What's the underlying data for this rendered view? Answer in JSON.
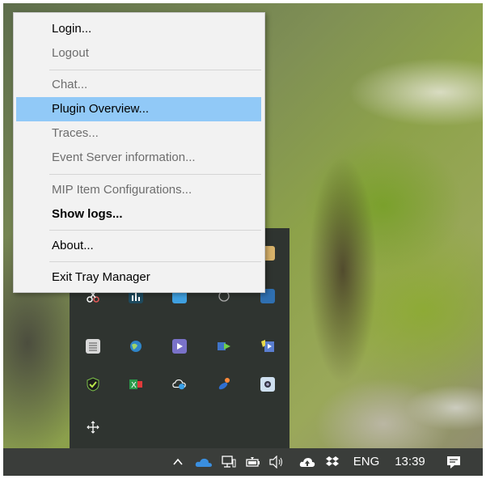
{
  "context_menu": {
    "items": [
      {
        "label": "Login...",
        "state": "enabled"
      },
      {
        "label": "Logout",
        "state": "disabled"
      },
      {
        "label": "Chat...",
        "state": "disabled"
      },
      {
        "label": "Plugin Overview...",
        "state": "highlighted"
      },
      {
        "label": "Traces...",
        "state": "disabled"
      },
      {
        "label": "Event Server information...",
        "state": "disabled"
      },
      {
        "label": "MIP Item Configurations...",
        "state": "disabled"
      },
      {
        "label": "Show logs...",
        "state": "bold"
      },
      {
        "label": "About...",
        "state": "enabled"
      },
      {
        "label": "Exit Tray Manager",
        "state": "enabled"
      }
    ],
    "highlight_color": "#91c9f7"
  },
  "tray_flyout": {
    "icons": [
      "scissors-icon",
      "chart-icon",
      "monitor-icon",
      "at-icon",
      "device-icon",
      "document-icon",
      "globe-icon",
      "video-icon",
      "media-player-icon",
      "media-folder-icon",
      "shield-check-icon",
      "excel-icon",
      "cloud-sync-icon",
      "satellite-icon",
      "camera-icon",
      "move-arrows-icon"
    ]
  },
  "taskbar": {
    "icons": [
      "chevron-up-icon",
      "onedrive-cloud-icon",
      "network-icon",
      "battery-icon",
      "speaker-icon",
      "upload-cloud-icon",
      "dropbox-icon"
    ],
    "language": "ENG",
    "clock": "13:39",
    "notification_icon": "action-center-icon"
  }
}
